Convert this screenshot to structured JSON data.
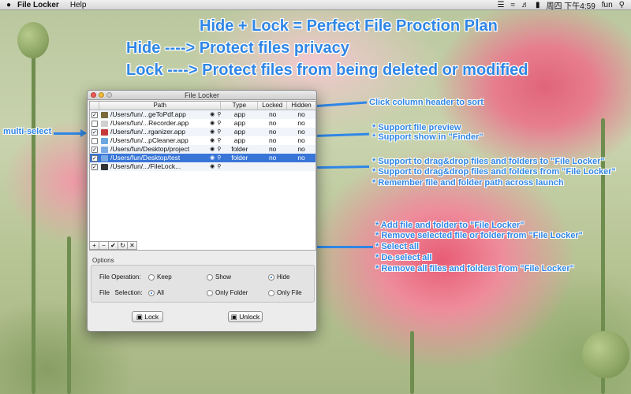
{
  "menubar": {
    "apple_icon": "apple-icon",
    "app_name": "File Locker",
    "help": "Help",
    "clock": "周四 下午4:59",
    "user": "fun",
    "tray_icons": [
      "battery-icon",
      "wifi-icon",
      "volume-icon",
      "search-icon",
      "list-icon"
    ]
  },
  "headlines": {
    "line1": "Hide + Lock = Perfect File Proction Plan",
    "line2": "Hide  ----> Protect files privacy",
    "line3": "Lock  ----> Protect files from being deleted or modified"
  },
  "annotations": {
    "sort": "Click column header to sort",
    "multiselect": "multi-select",
    "preview1": "* Support file preview",
    "preview2": "* Support show in \"Finder\"",
    "drag1": "* Support to drag&drop files and folders to \"File Locker\"",
    "drag2": "* Support  to drag&drop files and folders from \"File Locker\"",
    "drag3": "* Remember file and folder path across launch",
    "tool1": "* Add file and folder to \"File Locker\"",
    "tool2": "* Remove selected file or folder from \"File Locker\"",
    "tool3": "* Select all",
    "tool4": "* De-select all",
    "tool5": "* Remove all files and folders from \"File Locker\""
  },
  "window": {
    "title": "File Locker",
    "columns": {
      "path": "Path",
      "type": "Type",
      "locked": "Locked",
      "hidden": "Hidden"
    },
    "rows": [
      {
        "checked": true,
        "path": "/Users/fun/...geToPdf.app",
        "type": "app",
        "locked": "no",
        "hidden": "no",
        "icon_color": "#7a6a3a"
      },
      {
        "checked": false,
        "path": "/Users/fun/...Recorder.app",
        "type": "app",
        "locked": "no",
        "hidden": "no",
        "icon_color": "#d0d0d0"
      },
      {
        "checked": true,
        "path": "/Users/fun/...rganizer.app",
        "type": "app",
        "locked": "no",
        "hidden": "no",
        "icon_color": "#c43a3a"
      },
      {
        "checked": false,
        "path": "/Users/fun/...pCleaner.app",
        "type": "app",
        "locked": "no",
        "hidden": "no",
        "icon_color": "#6aa6e0"
      },
      {
        "checked": true,
        "path": "/Users/fun/Desktop/project",
        "type": "folder",
        "locked": "no",
        "hidden": "no",
        "icon_color": "#79a9e3"
      },
      {
        "checked": true,
        "path": "/Users/fun/Desktop/test",
        "type": "folder",
        "locked": "no",
        "hidden": "no",
        "icon_color": "#79a9e3",
        "selected": true
      },
      {
        "checked": true,
        "path": "/Users/fun/.../FileLock...",
        "type": "",
        "locked": "",
        "hidden": "",
        "icon_color": "#333333"
      }
    ],
    "toolbar": [
      "+",
      "−",
      "✔",
      "↻",
      "✕"
    ],
    "options": {
      "label": "Options",
      "file_operation": "File Operation:",
      "keep": "Keep",
      "show": "Show",
      "hide": "Hide",
      "file_selection": "File   Selection:",
      "all": "All",
      "only_folder": "Only Folder",
      "only_file": "Only File"
    },
    "buttons": {
      "lock": "Lock",
      "unlock": "Unlock"
    }
  },
  "colors": {
    "annotation": "#2f86e6",
    "selection": "#3875d7"
  }
}
